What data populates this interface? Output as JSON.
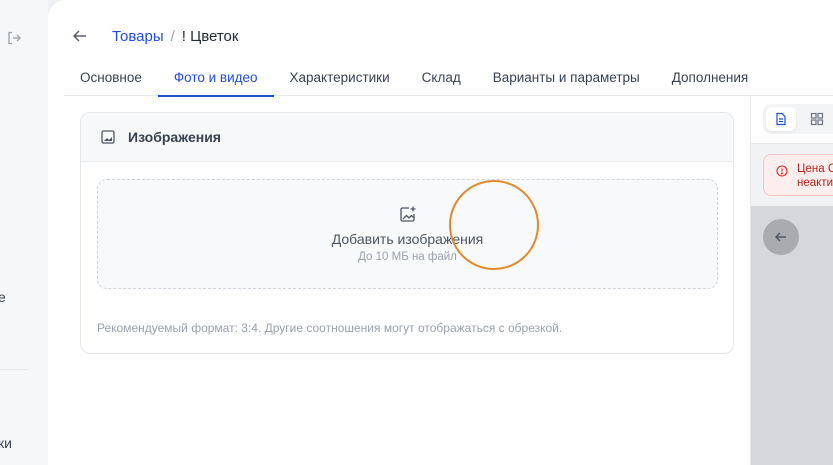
{
  "sidebar": {
    "partial_text_1": "е",
    "partial_text_2": "ки"
  },
  "breadcrumb": {
    "parent": "Товары",
    "separator": "/",
    "current": "! Цветок"
  },
  "tabs": [
    {
      "label": "Основное"
    },
    {
      "label": "Фото и видео",
      "active": true
    },
    {
      "label": "Характеристики"
    },
    {
      "label": "Склад"
    },
    {
      "label": "Варианты и параметры"
    },
    {
      "label": "Дополнения"
    }
  ],
  "images_card": {
    "title": "Изображения",
    "dropzone_title": "Добавить изображения",
    "dropzone_subtitle": "До 10 МБ на файл",
    "note": "Рекомендуемый формат: 3:4. Другие соотношения могут отображаться с обрезкой."
  },
  "right_panel": {
    "alert_line1": "Цена С",
    "alert_line2": "неакти"
  },
  "colors": {
    "accent": "#1d4ed8",
    "alert_bg": "#fdeeee",
    "alert_text": "#b42318",
    "click_ring": "#e08a2c"
  },
  "icons": [
    "logout-icon",
    "arrow-left-icon",
    "image-icon",
    "add-image-icon",
    "document-icon",
    "grid-icon",
    "warning-icon"
  ]
}
